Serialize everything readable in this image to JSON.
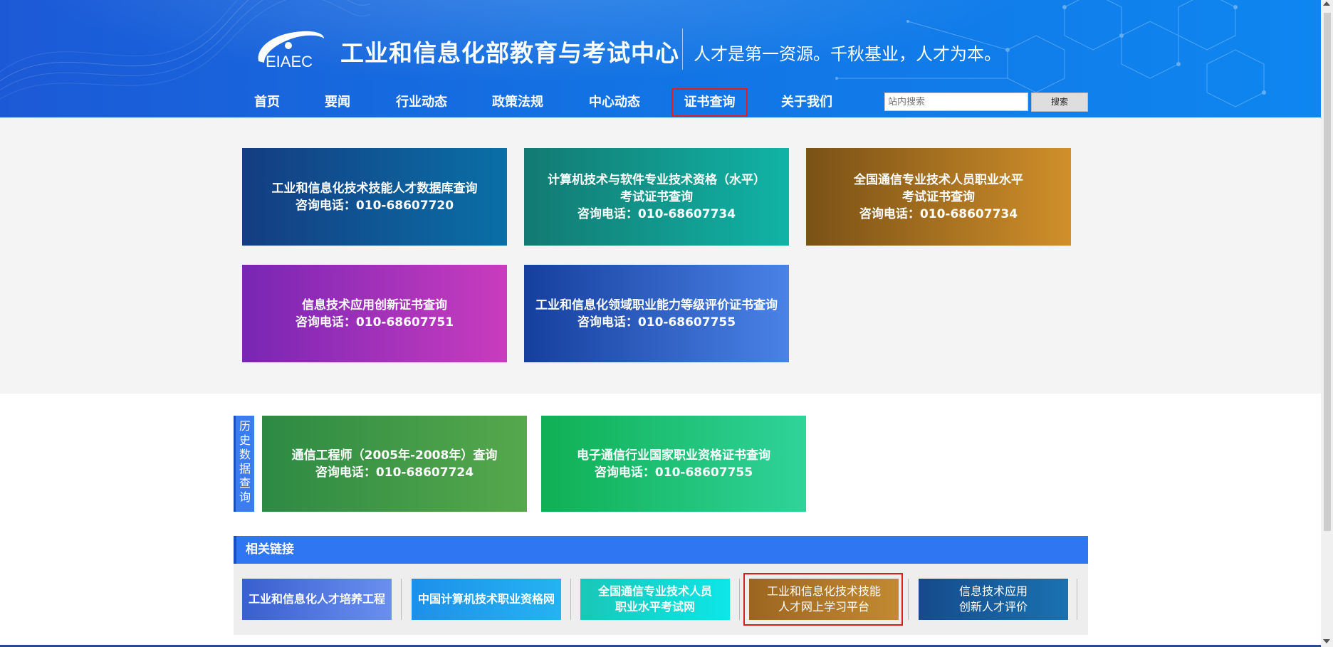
{
  "header": {
    "logo_text": "EIAEC",
    "site_title": "工业和信息化部教育与考试中心",
    "slogan": "人才是第一资源。千秋基业，人才为本。",
    "nav": [
      {
        "label": "首页"
      },
      {
        "label": "要闻"
      },
      {
        "label": "行业动态"
      },
      {
        "label": "政策法规"
      },
      {
        "label": "中心动态"
      },
      {
        "label": "证书查询",
        "active": true
      },
      {
        "label": "关于我们"
      }
    ],
    "search": {
      "placeholder": "站内搜索",
      "button_label": "搜索"
    }
  },
  "query_cards": [
    {
      "lines": [
        "工业和信息化技术技能人才数据库查询",
        "咨询电话：010-68607720"
      ]
    },
    {
      "lines": [
        "计算机技术与软件专业技术资格（水平）",
        "考试证书查询",
        "咨询电话：010-68607734"
      ]
    },
    {
      "lines": [
        "全国通信专业技术人员职业水平",
        "考试证书查询",
        "咨询电话：010-68607734"
      ]
    },
    {
      "lines": [
        "信息技术应用创新证书查询",
        "咨询电话：010-68607751"
      ]
    },
    {
      "lines": [
        "工业和信息化领域职业能力等级评价证书查询",
        "咨询电话：010-68607755"
      ]
    }
  ],
  "history": {
    "tab_chars": [
      "历",
      "史",
      "数",
      "据",
      "查",
      "询"
    ],
    "cards": [
      {
        "lines": [
          "通信工程师（2005年-2008年）查询",
          "咨询电话：010-68607724"
        ]
      },
      {
        "lines": [
          "电子通信行业国家职业资格证书查询",
          "咨询电话：010-68607755"
        ]
      }
    ]
  },
  "related_links": {
    "title": "相关链接",
    "tiles": [
      {
        "lines": [
          "工业和信息化人才培养工程"
        ]
      },
      {
        "lines": [
          "中国计算机技术职业资格网"
        ]
      },
      {
        "lines": [
          "全国通信专业技术人员",
          "职业水平考试网"
        ]
      },
      {
        "lines": [
          "工业和信息化技术技能",
          "人才网上学习平台"
        ],
        "highlighted": true
      },
      {
        "lines": [
          "信息技术应用",
          "创新人才评价"
        ]
      }
    ]
  },
  "colors": {
    "header_blue": "#1372e3",
    "nav_highlight": "#e02020",
    "links_bar": "#2f76f2"
  }
}
